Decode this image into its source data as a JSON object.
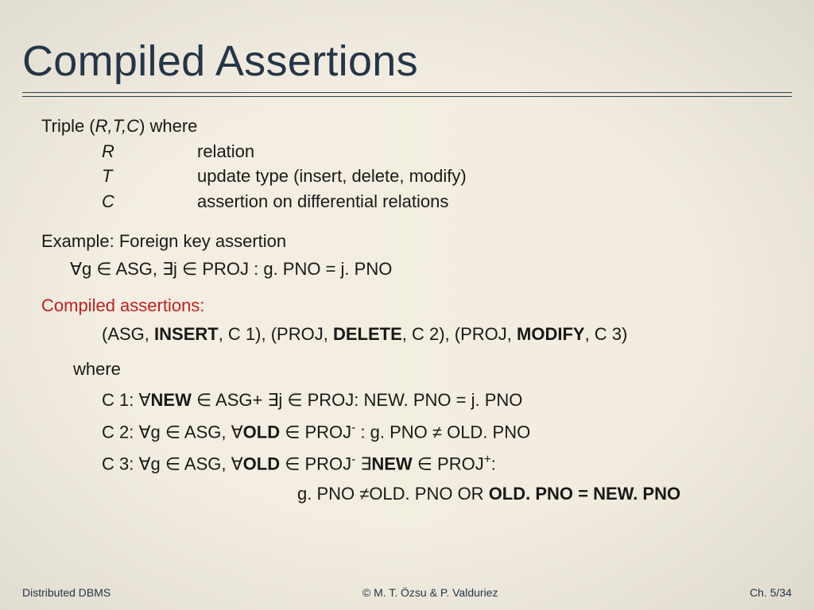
{
  "title": "Compiled Assertions",
  "triple": {
    "header": "Triple (R,T,C) where",
    "rows": [
      {
        "sym": "R",
        "desc": "relation"
      },
      {
        "sym": "T",
        "desc": "update type (insert, delete, modify)"
      },
      {
        "sym": "C",
        "desc": "assertion on differential relations"
      }
    ]
  },
  "example": {
    "header": "Example: Foreign key assertion",
    "formula": "∀g ∈ ASG, ∃j ∈ PROJ :  g. PNO = j. PNO"
  },
  "compiled": {
    "header": "Compiled assertions:",
    "triples": {
      "open1": "(ASG, ",
      "op1": "INSERT",
      "mid1": ", C 1), (PROJ, ",
      "op2": "DELETE",
      "mid2": ", C 2), (PROJ, ",
      "op3": "MODIFY",
      "close": ", C 3)"
    },
    "where": "where",
    "c1": {
      "prefix": "C 1: ∀",
      "newkw": "NEW",
      "rest": " ∈ ASG+   ∃j ∈ PROJ: NEW. PNO = j. PNO"
    },
    "c2": {
      "prefix": "C 2: ∀g ∈ ASG, ∀",
      "oldkw": "OLD",
      "mid": " ∈ PROJ",
      "sup": "-",
      "tail": " : g. PNO ≠ OLD. PNO"
    },
    "c3": {
      "prefix": "C 3: ∀g ∈ ASG, ∀",
      "oldkw": "OLD ",
      "mid1": " ∈ PROJ",
      "sup1": "-",
      "mid2": "  ∃",
      "newkw": "NEW",
      "mid3": " ∈ PROJ",
      "sup2": "+",
      "tail": ":",
      "line2_a": "g. PNO ≠OLD. PNO OR ",
      "line2_b": "OLD. PNO = NEW. PNO"
    }
  },
  "footer": {
    "left": "Distributed DBMS",
    "center": "© M. T. Özsu & P. Valduriez",
    "right": "Ch. 5/34"
  }
}
